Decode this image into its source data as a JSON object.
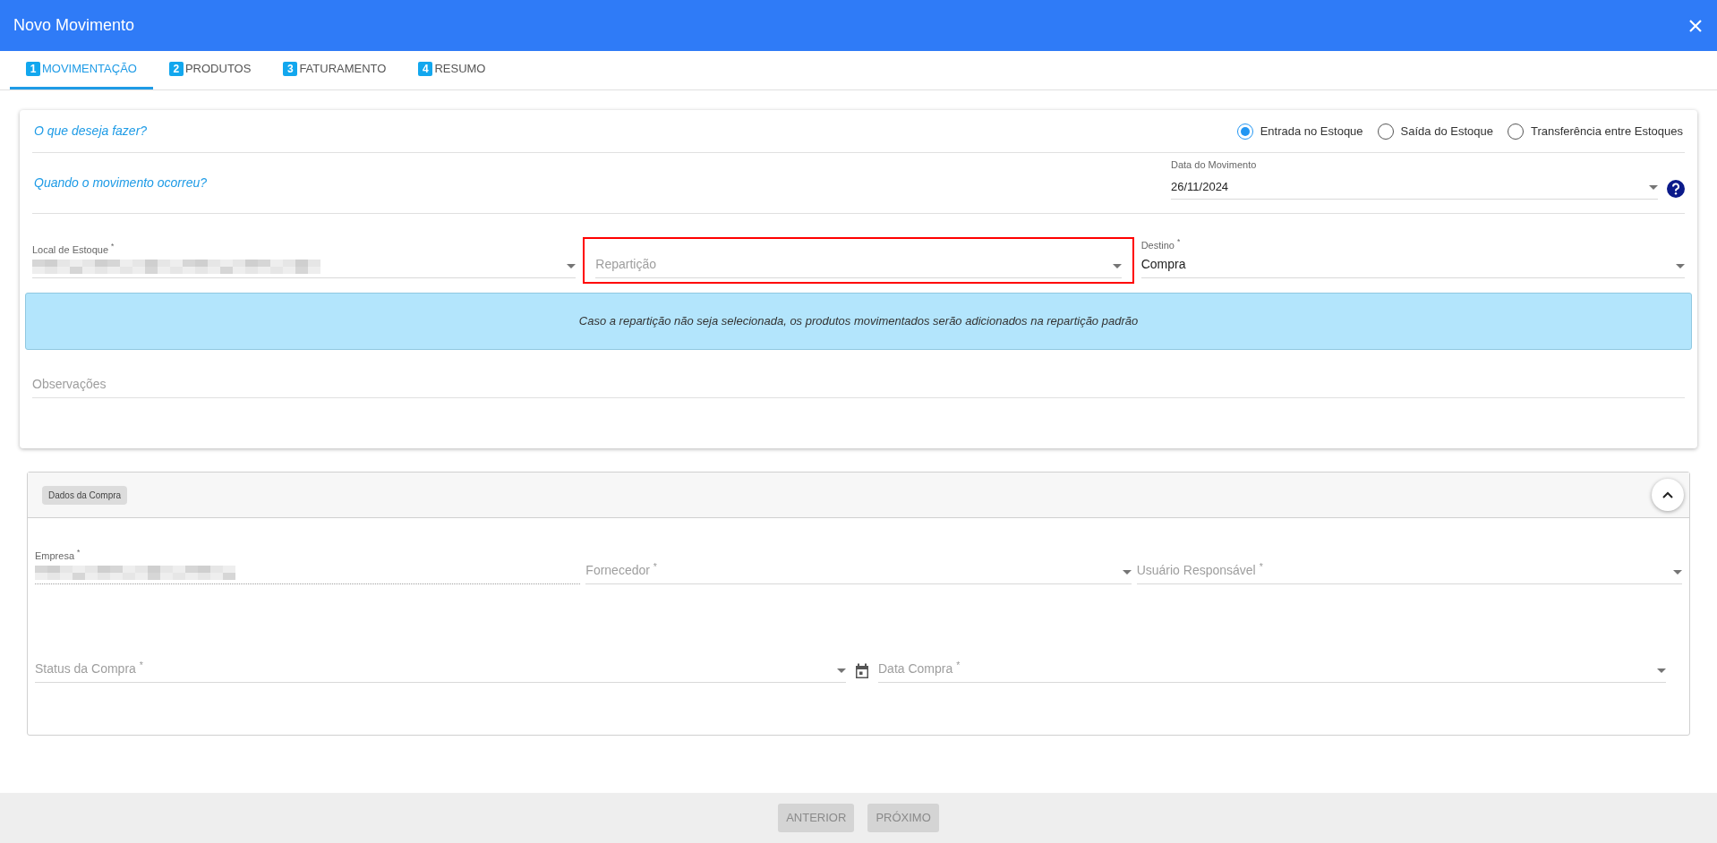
{
  "dialog": {
    "title": "Novo Movimento"
  },
  "tabs": [
    {
      "number": "1",
      "label": "MOVIMENTAÇÃO",
      "selected": true
    },
    {
      "number": "2",
      "label": "PRODUTOS",
      "selected": false
    },
    {
      "number": "3",
      "label": "FATURAMENTO",
      "selected": false
    },
    {
      "number": "4",
      "label": "RESUMO",
      "selected": false
    }
  ],
  "movement": {
    "question": "O que deseja fazer?",
    "options": [
      {
        "label": "Entrada no Estoque",
        "selected": true
      },
      {
        "label": "Saída do Estoque",
        "selected": false
      },
      {
        "label": "Transferência entre Estoques",
        "selected": false
      }
    ]
  },
  "date_row": {
    "question": "Quando o movimento ocorreu?",
    "field": {
      "label": "Data do Movimento",
      "value": "26/11/2024"
    }
  },
  "location_fields": [
    {
      "label": "Local de Estoque $^{*}$",
      "redacted": true,
      "highlighted": false
    },
    {
      "placeholder": "Repartição",
      "highlighted": true
    },
    {
      "label": "Destino $^{*}$",
      "value": "Compra",
      "highlighted": false
    }
  ],
  "info": "Caso a repartição não seja selecionada, os produtos movimentados serão adicionados na repartição padrão",
  "notes": {
    "placeholder": "Observações"
  },
  "purchase": {
    "badge": "Dados da Compra",
    "expanded": true,
    "row_1": [
      {
        "kind": "readonly",
        "label": "Empresa $^{*}$",
        "redacted": true
      },
      {
        "kind": "select",
        "placeholder": "Fornecedor $^{*}$"
      },
      {
        "kind": "select",
        "placeholder": "Usuário Responsável $^{*}$"
      }
    ],
    "row_2": [
      {
        "kind": "select",
        "placeholder": "Status da Compra $^{*}$"
      },
      {
        "kind": "date",
        "placeholder": "Data Compra $^{*}$"
      }
    ]
  },
  "buttons": [
    {
      "label": "ANTERIOR",
      "disabled": true
    },
    {
      "label": "PRÓXIMO",
      "disabled": true
    }
  ]
}
